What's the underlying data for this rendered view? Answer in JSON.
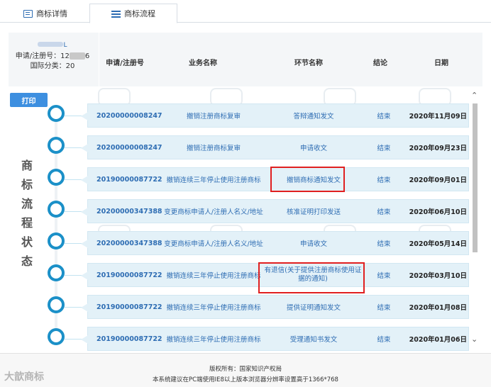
{
  "tabs": [
    {
      "label": "商标详情",
      "icon": "document-icon"
    },
    {
      "label": "商标流程",
      "icon": "list-icon"
    }
  ],
  "mark_info": {
    "name_suffix": "L",
    "reg_prefix": "申请/注册号：12",
    "reg_suffix": "6",
    "class_label": "国际分类：20"
  },
  "columns": {
    "reg": "申请/注册号",
    "biz": "业务名称",
    "step": "环节名称",
    "result": "结论",
    "date": "日期"
  },
  "print_label": "打印",
  "side_title": [
    "商",
    "标",
    "流",
    "程",
    "状",
    "态"
  ],
  "rows": [
    {
      "reg": "20200000008247",
      "biz": "撤销注册商标复审",
      "step": "答辩通知发文",
      "result": "结束",
      "date": "2020年11月09日"
    },
    {
      "reg": "20200000008247",
      "biz": "撤销注册商标复审",
      "step": "申请收文",
      "result": "结束",
      "date": "2020年09月23日"
    },
    {
      "reg": "20190000087722",
      "biz": "撤销连续三年停止使用注册商标",
      "step": "撤销商标通知发文",
      "result": "结束",
      "date": "2020年09月01日"
    },
    {
      "reg": "20200000347388",
      "biz": "变更商标申请人/注册人名义/地址",
      "step": "核准证明打印发送",
      "result": "结束",
      "date": "2020年06月10日"
    },
    {
      "reg": "20200000347388",
      "biz": "变更商标申请人/注册人名义/地址",
      "step": "申请收文",
      "result": "结束",
      "date": "2020年05月14日"
    },
    {
      "reg": "20190000087722",
      "biz": "撤销连续三年停止使用注册商标",
      "step": "有退信(关于提供注册商标使用证据的通知)",
      "result": "结束",
      "date": "2020年03月10日"
    },
    {
      "reg": "20190000087722",
      "biz": "撤销连续三年停止使用注册商标",
      "step": "提供证明通知发文",
      "result": "结束",
      "date": "2020年01月08日"
    },
    {
      "reg": "20190000087722",
      "biz": "撤销连续三年停止使用注册商标",
      "step": "受理通知书发文",
      "result": "结束",
      "date": "2020年01月06日"
    }
  ],
  "footer": {
    "copyright": "版权所有：国家知识产权局",
    "note": "本系统建议在PC端使用IE8以上版本浏览器分辨率设置高于1366*768",
    "logo_text": "大歆商标"
  },
  "colors": {
    "accent": "#2e6db3",
    "circle": "#1b90c8",
    "row_bg": "#e3f1f8",
    "highlight": "#e02020",
    "print_btn": "#3d8fe0"
  }
}
